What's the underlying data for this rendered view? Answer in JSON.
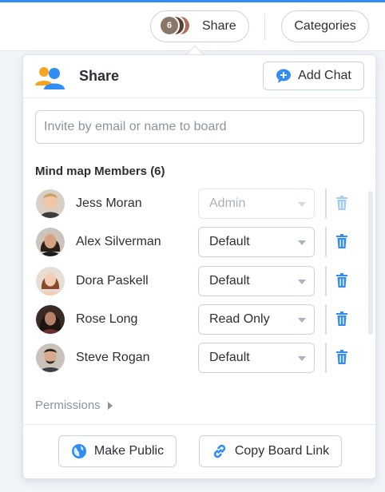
{
  "topbar": {
    "share_label": "Share",
    "share_avatar_count": "6",
    "categories_label": "Categories"
  },
  "panel": {
    "title": "Share",
    "add_chat_label": "Add Chat",
    "invite_placeholder": "Invite by email or name to board",
    "members_title": "Mind map Members (6)",
    "permissions_label": "Permissions",
    "make_public_label": "Make Public",
    "copy_link_label": "Copy Board Link"
  },
  "members": [
    {
      "name": "Jess Moran",
      "role": "Admin",
      "disabled": true
    },
    {
      "name": "Alex Silverman",
      "role": "Default",
      "disabled": false
    },
    {
      "name": "Dora Paskell",
      "role": "Default",
      "disabled": false
    },
    {
      "name": "Rose Long",
      "role": "Read Only",
      "disabled": false
    },
    {
      "name": "Steve Rogan",
      "role": "Default",
      "disabled": false
    }
  ],
  "colors": {
    "accent": "#2f8df5",
    "people_icon_orange": "#f4a623",
    "people_icon_blue": "#2f8df5",
    "trash": "#2f8df5"
  }
}
